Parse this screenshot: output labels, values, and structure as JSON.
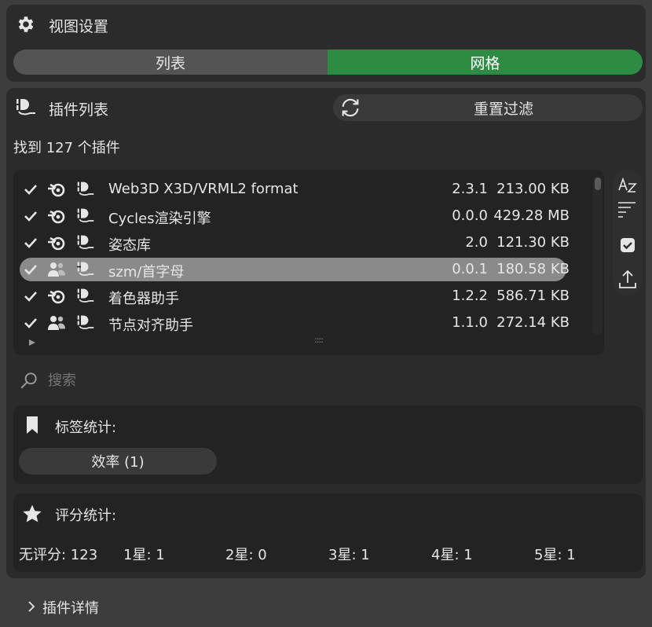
{
  "view_settings": {
    "title": "视图设置",
    "icon": "gear-icon",
    "segments": [
      {
        "label": "列表",
        "active": false
      },
      {
        "label": "网格",
        "active": true
      }
    ],
    "active_color": "#2e8b43"
  },
  "plugin_list": {
    "title": "插件列表",
    "reset_label": "重置过滤",
    "found_text": "找到 127 个插件",
    "rows": [
      {
        "name": "Web3D X3D/VRML2 format",
        "version": "2.3.1",
        "size": "213.00 KB",
        "source_icon": "blender-icon",
        "selected": false
      },
      {
        "name": "Cycles渲染引擎",
        "version": "0.0.0",
        "size": "429.28 MB",
        "source_icon": "blender-icon",
        "selected": false
      },
      {
        "name": "姿态库",
        "version": "2.0",
        "size": "121.30 KB",
        "source_icon": "blender-icon",
        "selected": false
      },
      {
        "name": "szm/首字母",
        "version": "0.0.1",
        "size": "180.58 KB",
        "source_icon": "users-icon",
        "selected": true
      },
      {
        "name": "着色器助手",
        "version": "1.2.2",
        "size": "586.71 KB",
        "source_icon": "blender-icon",
        "selected": false
      },
      {
        "name": "节点对齐助手",
        "version": "1.1.0",
        "size": "272.14 KB",
        "source_icon": "users-icon",
        "selected": false
      }
    ],
    "grip": "::::"
  },
  "search": {
    "placeholder": "搜索"
  },
  "tag_stats": {
    "title": "标签统计:",
    "tags": [
      {
        "label": "效率 (1)"
      }
    ]
  },
  "rating_stats": {
    "title": "评分统计:",
    "items": [
      "无评分: 123",
      "1星: 1",
      "2星: 0",
      "3星: 1",
      "4星: 1",
      "5星: 1"
    ]
  },
  "details": {
    "label": "插件详情"
  }
}
